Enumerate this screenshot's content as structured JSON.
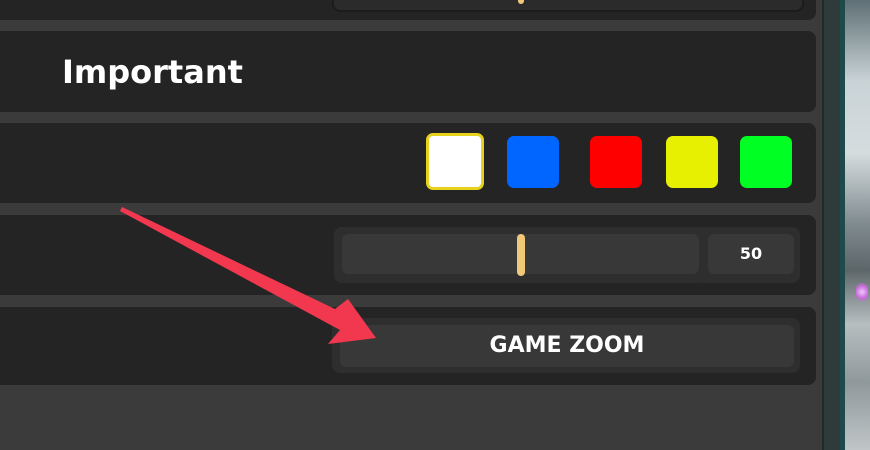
{
  "settings": {
    "section_title": "Important",
    "color_options": [
      {
        "name": "white",
        "color": "#ffffff",
        "selected": true
      },
      {
        "name": "blue",
        "color": "#0066ff",
        "selected": false
      },
      {
        "name": "red",
        "color": "#ff0000",
        "selected": false
      },
      {
        "name": "yellow",
        "color": "#e6f000",
        "selected": false
      },
      {
        "name": "green",
        "color": "#00ff22",
        "selected": false
      }
    ],
    "slider": {
      "value": "50",
      "fraction": 0.5
    },
    "zoom_button_label": "GAME ZOOM"
  },
  "colors": {
    "panel_bg": "#242424",
    "accent": "#f0c878",
    "selected_border": "#e6d21a",
    "arrow": "#f2384f"
  }
}
